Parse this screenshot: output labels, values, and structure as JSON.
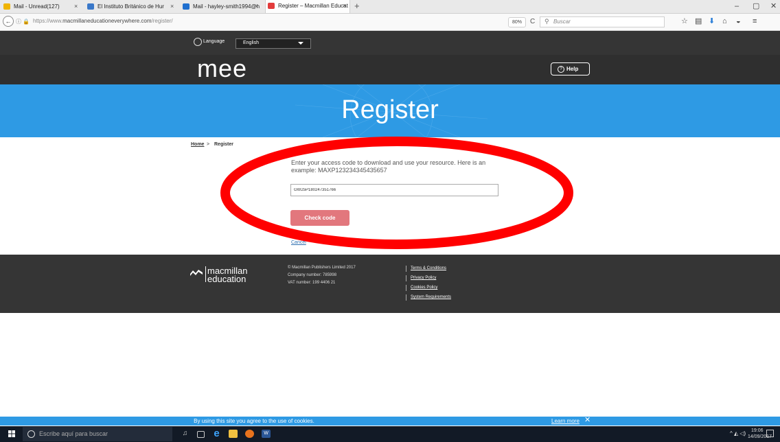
{
  "browser": {
    "tabs": [
      {
        "label": "Mail - Unread(127)",
        "close": "×",
        "icon_color": "#f0b400"
      },
      {
        "label": "El Instituto Británico de Hur",
        "close": "×",
        "icon_color": "#3a78c9"
      },
      {
        "label": "Mail - hayley-smith1994@h",
        "close": "×",
        "icon_color": "#1f6fcf"
      },
      {
        "label": "Register – Macmillan Educat",
        "close": "×",
        "icon_color": "#e23b3b"
      }
    ],
    "new_tab": "+",
    "window_controls": {
      "minimize": "–",
      "maximize": "▢",
      "close": "✕"
    },
    "back": "←",
    "url": {
      "host_prefix": "https://www.",
      "host": "macmillaneducationeverywhere.com",
      "path": "/register/"
    },
    "zoom": "80%",
    "reload": "C",
    "search_placeholder": "Buscar"
  },
  "site": {
    "language_label": "Language",
    "language_value": "English",
    "logo": "mee",
    "help": "Help",
    "banner_title": "Register",
    "breadcrumb": {
      "home": "Home",
      "separator": ">",
      "current": "Register"
    },
    "instructions": "Enter your access code to download and use your resource. Here is an example: MAXP123234345435657",
    "code_value": "GW25P180247351766",
    "check_button": "Check code",
    "cancel": "Cancel"
  },
  "footer": {
    "brand_line1": "macmillan",
    "brand_line2": "education",
    "info": [
      "© Macmillan Publishers Limited 2017",
      "Company number: 785998",
      "VAT number: 199 4406 21"
    ],
    "links": [
      "Terms & Conditions",
      "Privacy Policy",
      "Cookies Policy",
      "System Requirements"
    ]
  },
  "cookie_bar": {
    "text": "By using this site you agree to the use of cookies.",
    "learn_more": "Learn more",
    "close": "✕"
  },
  "taskbar": {
    "search_placeholder": "Escribe aquí para buscar",
    "time": "19:06",
    "date": "14/09/2017"
  },
  "colors": {
    "banner": "#2e9ae4",
    "dark_header": "#353535",
    "check_button": "#e2777d",
    "annotation": "#ff0000"
  }
}
